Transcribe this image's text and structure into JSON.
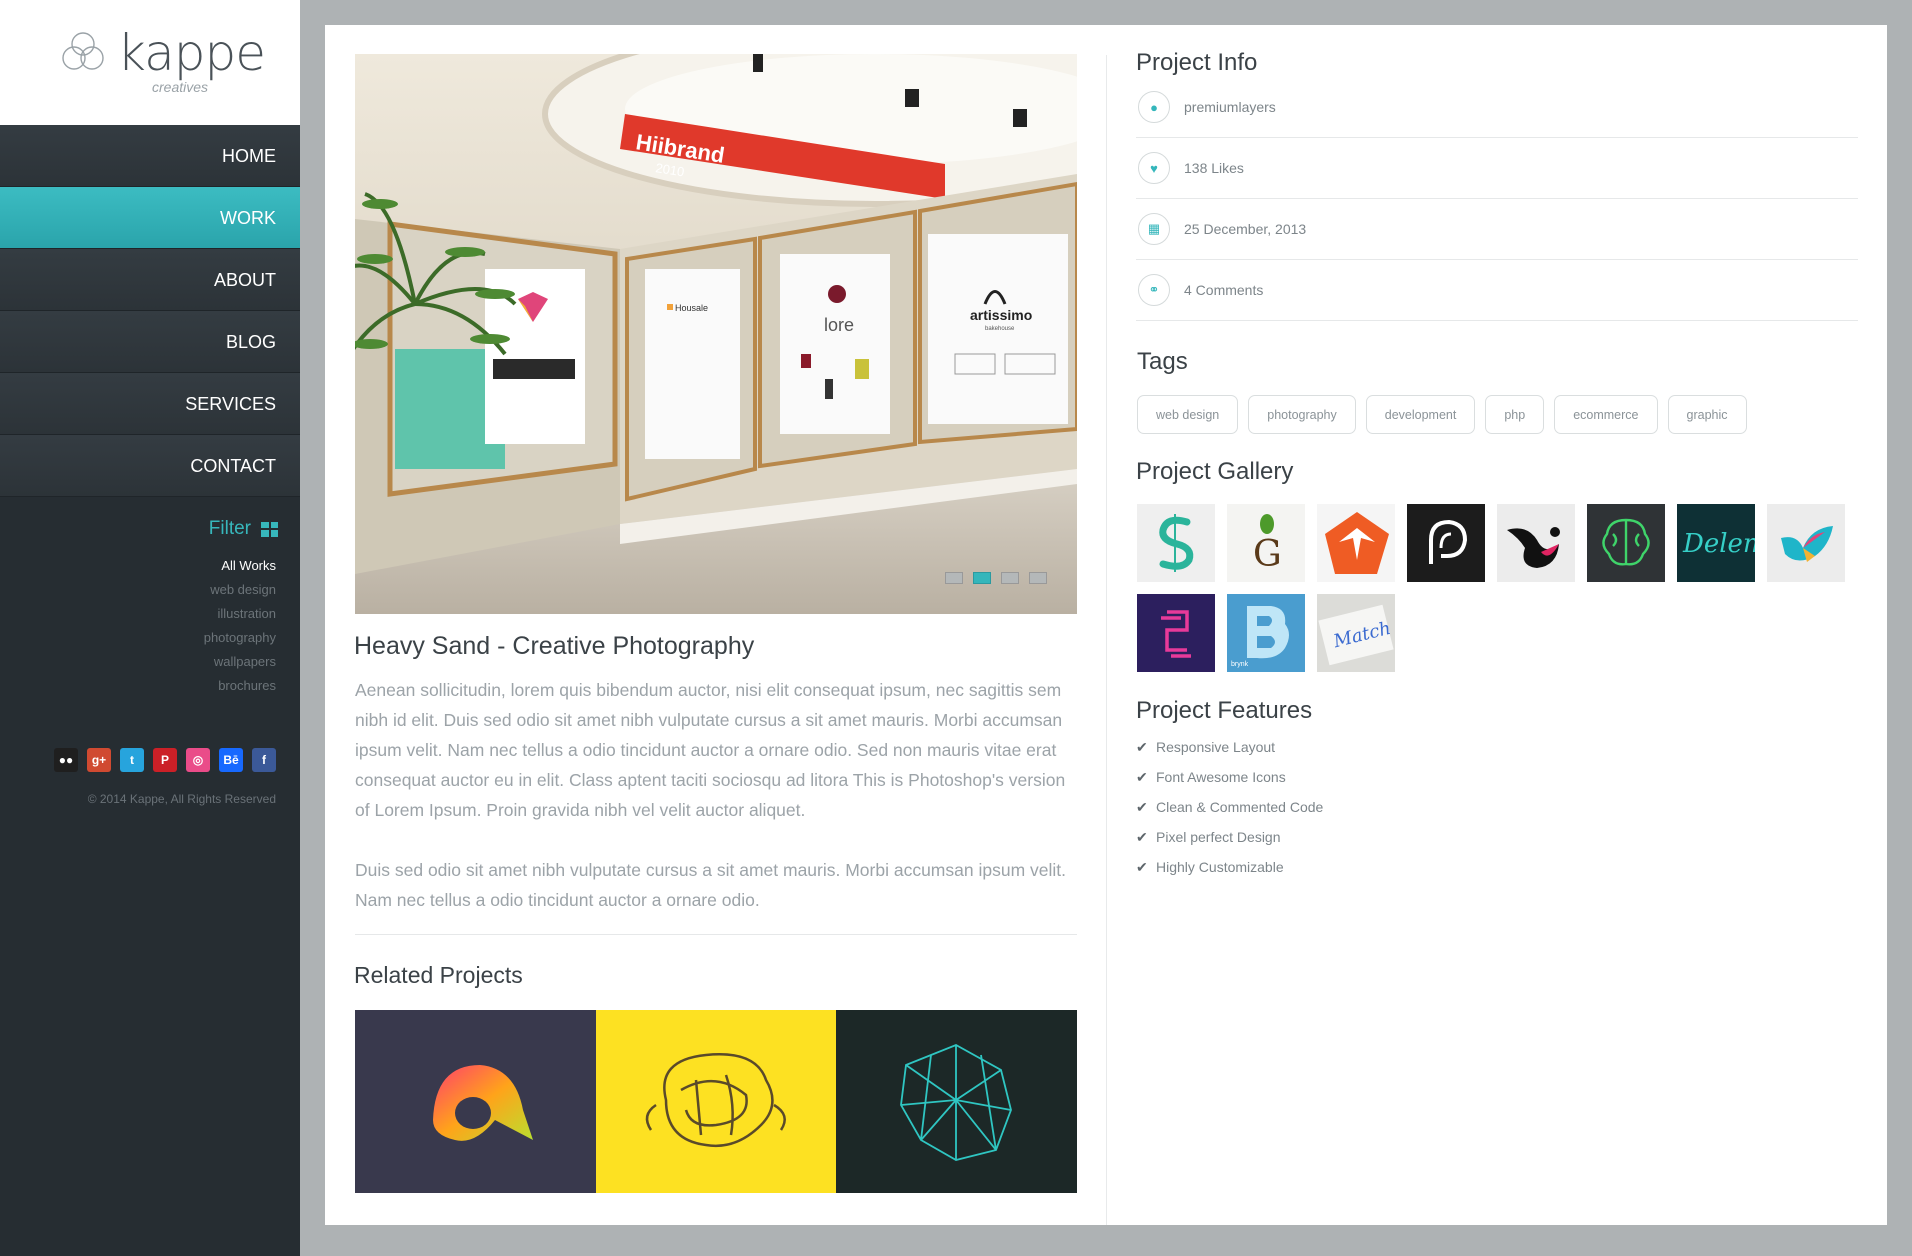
{
  "brand": {
    "name": "kappe",
    "tagline": "creatives"
  },
  "nav": {
    "items": [
      {
        "label": "HOME",
        "active": false
      },
      {
        "label": "WORK",
        "active": true
      },
      {
        "label": "ABOUT",
        "active": false
      },
      {
        "label": "BLOG",
        "active": false
      },
      {
        "label": "SERVICES",
        "active": false
      },
      {
        "label": "CONTACT",
        "active": false
      }
    ]
  },
  "filter": {
    "title": "Filter",
    "items": [
      "All Works",
      "web design",
      "illustration",
      "photography",
      "wallpapers",
      "brochures"
    ]
  },
  "social": [
    {
      "name": "flickr-icon",
      "glyph": "●●",
      "color": "#1f1f1f"
    },
    {
      "name": "google-plus-icon",
      "glyph": "g+",
      "color": "#d04a31"
    },
    {
      "name": "twitter-icon",
      "glyph": "t",
      "color": "#27a4dd"
    },
    {
      "name": "pinterest-icon",
      "glyph": "P",
      "color": "#cb2027"
    },
    {
      "name": "dribbble-icon",
      "glyph": "◎",
      "color": "#ea4c89"
    },
    {
      "name": "behance-icon",
      "glyph": "Bē",
      "color": "#1769ff"
    },
    {
      "name": "facebook-icon",
      "glyph": "f",
      "color": "#3b5998"
    }
  ],
  "copyright": "© 2014 Kappe, All Rights Reserved",
  "project": {
    "title": "Heavy Sand - Creative Photography",
    "paragraphs": [
      "Aenean sollicitudin, lorem quis bibendum auctor, nisi elit consequat ipsum, nec sagittis sem nibh id elit. Duis sed odio sit amet nibh vulputate cursus a sit amet mauris. Morbi accumsan ipsum velit. Nam nec tellus a odio tincidunt auctor a ornare odio. Sed non mauris vitae erat consequat auctor eu in elit. Class aptent taciti sociosqu ad litora This is Photoshop's version  of Lorem Ipsum. Proin gravida nibh vel velit auctor aliquet.",
      "Duis sed odio sit amet nibh vulputate cursus a sit amet mauris. Morbi accumsan ipsum velit. Nam nec tellus a odio tincidunt auctor a ornare odio."
    ],
    "slider": {
      "slides": 4,
      "active_index": 1
    },
    "hero_signs": {
      "banner_brand": "Hiibrand",
      "banner_year": "2010",
      "poster_brand_1": "lore",
      "poster_brand_2": "artissimo",
      "poster_brand_2_sub": "bakehouse",
      "poster_brand_3": "Housale"
    }
  },
  "related": {
    "title": "Related Projects"
  },
  "info": {
    "title": "Project Info",
    "rows": [
      {
        "icon": "user-icon",
        "glyph": "●",
        "text": "premiumlayers"
      },
      {
        "icon": "heart-icon",
        "glyph": "♥",
        "text": "138 Likes"
      },
      {
        "icon": "calendar-icon",
        "glyph": "▦",
        "text": "25 December, 2013"
      },
      {
        "icon": "link-icon",
        "glyph": "⚭",
        "text": "4 Comments"
      }
    ]
  },
  "tags": {
    "title": "Tags",
    "items": [
      "web design",
      "photography",
      "development",
      "php",
      "ecommerce",
      "graphic"
    ]
  },
  "gallery": {
    "title": "Project Gallery",
    "thumb_letters": {
      "t2": "G",
      "t7": "Delem",
      "t11": "brynk",
      "t12": "Match"
    }
  },
  "features": {
    "title": "Project Features",
    "items": [
      "Responsive Layout",
      "Font Awesome Icons",
      "Clean & Commented Code",
      "Pixel perfect Design",
      "Highly Customizable"
    ]
  },
  "colors": {
    "accent": "#34b6bb",
    "sidebar": "#262d32",
    "background": "#aeb2b4"
  }
}
